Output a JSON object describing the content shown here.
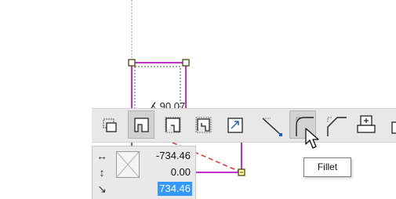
{
  "canvas": {
    "angle_label": "90.07",
    "angle_icon": "angle-icon",
    "shape_color": "#c231c9",
    "dimension_color": "#e03030",
    "guide_color": "#9a9a9a",
    "handle_color": "#3a3a00"
  },
  "toolbar": {
    "background": "#e8e8e8",
    "tools": [
      {
        "icon": "corner-offset-icon",
        "pressed": false
      },
      {
        "icon": "corner-notch-icon",
        "pressed": true
      },
      {
        "icon": "corner-step-icon",
        "pressed": false
      },
      {
        "icon": "corner-double-step-icon",
        "pressed": false
      },
      {
        "icon": "corner-arrow-box-icon",
        "pressed": false
      },
      {
        "icon": "diagonal-line-icon",
        "pressed": false
      },
      {
        "icon": "fillet-icon",
        "pressed": true
      },
      {
        "icon": "chamfer-icon",
        "pressed": false
      },
      {
        "icon": "add-stack-icon",
        "pressed": false
      },
      {
        "icon": "partial-tool-icon",
        "pressed": false
      }
    ]
  },
  "coordinates": {
    "x_icon": "horizontal-arrows-icon",
    "x_value": "-734.46",
    "y_icon": "vertical-arrows-icon",
    "y_value": "0.00",
    "length_icon": "diagonal-arrow-icon",
    "length_value": "734.46",
    "lock_icon": "lock-icon"
  },
  "tooltip": {
    "text": "Fillet"
  }
}
